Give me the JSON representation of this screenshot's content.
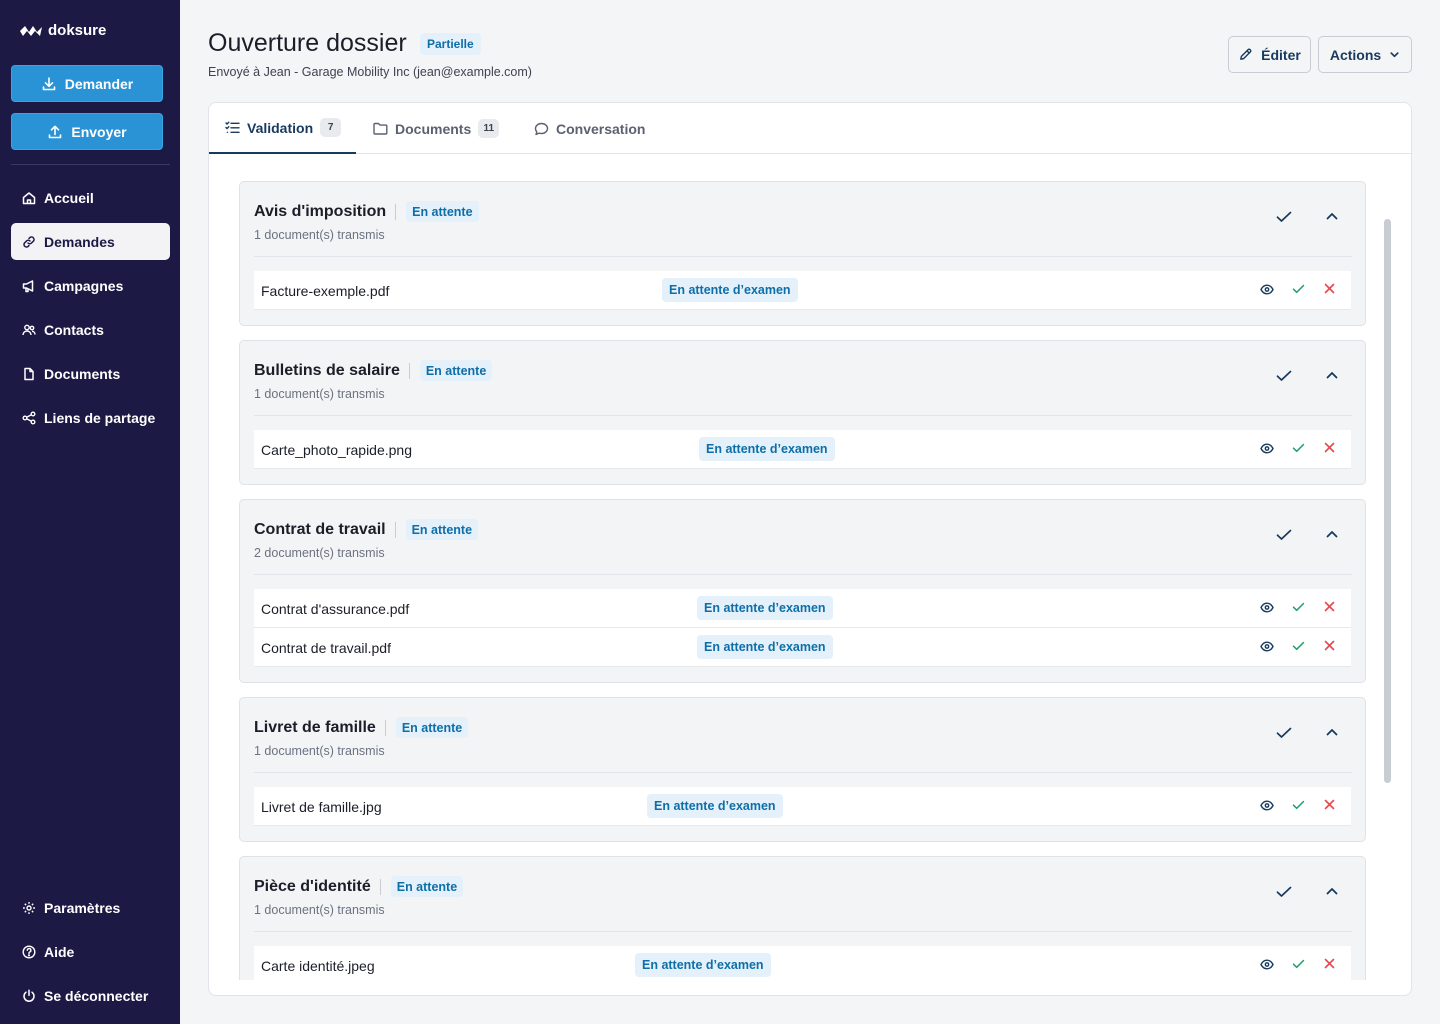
{
  "brand": {
    "name": "doksure"
  },
  "sidebar": {
    "request_label": "Demander",
    "send_label": "Envoyer",
    "nav": [
      {
        "label": "Accueil",
        "icon": "home-icon"
      },
      {
        "label": "Demandes",
        "icon": "link-icon",
        "active": true
      },
      {
        "label": "Campagnes",
        "icon": "megaphone-icon"
      },
      {
        "label": "Contacts",
        "icon": "contacts-icon"
      },
      {
        "label": "Documents",
        "icon": "file-icon"
      },
      {
        "label": "Liens de partage",
        "icon": "share-icon"
      }
    ],
    "bottom": [
      {
        "label": "Paramètres",
        "icon": "gear-icon"
      },
      {
        "label": "Aide",
        "icon": "help-icon"
      },
      {
        "label": "Se déconnecter",
        "icon": "power-icon"
      }
    ]
  },
  "header": {
    "title": "Ouverture dossier",
    "status": "Partielle",
    "subtitle": "Envoyé à Jean - Garage Mobility Inc (jean@example.com)",
    "edit_label": "Éditer",
    "actions_label": "Actions"
  },
  "tabs": [
    {
      "label": "Validation",
      "count": "7",
      "icon": "checklist-icon",
      "active": true
    },
    {
      "label": "Documents",
      "count": "11",
      "icon": "folder-icon"
    },
    {
      "label": "Conversation",
      "count": "",
      "icon": "chat-icon"
    }
  ],
  "sections": [
    {
      "title": "Avis d'imposition",
      "status": "En attente",
      "subtitle": "1 document(s) transmis",
      "documents": [
        {
          "name": "Facture-exemple.pdf",
          "status": "En attente d’examen"
        }
      ]
    },
    {
      "title": "Bulletins de salaire",
      "status": "En attente",
      "subtitle": "1 document(s) transmis",
      "documents": [
        {
          "name": "Carte_photo_rapide.png",
          "status": "En attente d’examen"
        }
      ]
    },
    {
      "title": "Contrat de travail",
      "status": "En attente",
      "subtitle": "2 document(s) transmis",
      "documents": [
        {
          "name": "Contrat d'assurance.pdf",
          "status": "En attente d’examen"
        },
        {
          "name": "Contrat de travail.pdf",
          "status": "En attente d’examen"
        }
      ]
    },
    {
      "title": "Livret de famille",
      "status": "En attente",
      "subtitle": "1 document(s) transmis",
      "documents": [
        {
          "name": "Livret de famille.jpg",
          "status": "En attente d’examen"
        }
      ]
    },
    {
      "title": "Pièce d'identité",
      "status": "En attente",
      "subtitle": "1 document(s) transmis",
      "documents": [
        {
          "name": "Carte identité.jpeg",
          "status": "En attente d’examen"
        }
      ]
    }
  ],
  "colors": {
    "sidebar": "#1c1a45",
    "accent": "#2a93d5",
    "badge_bg": "#e4f1fb",
    "badge_text": "#0e6ea8",
    "approve": "#22a06b",
    "reject": "#e5484d"
  }
}
